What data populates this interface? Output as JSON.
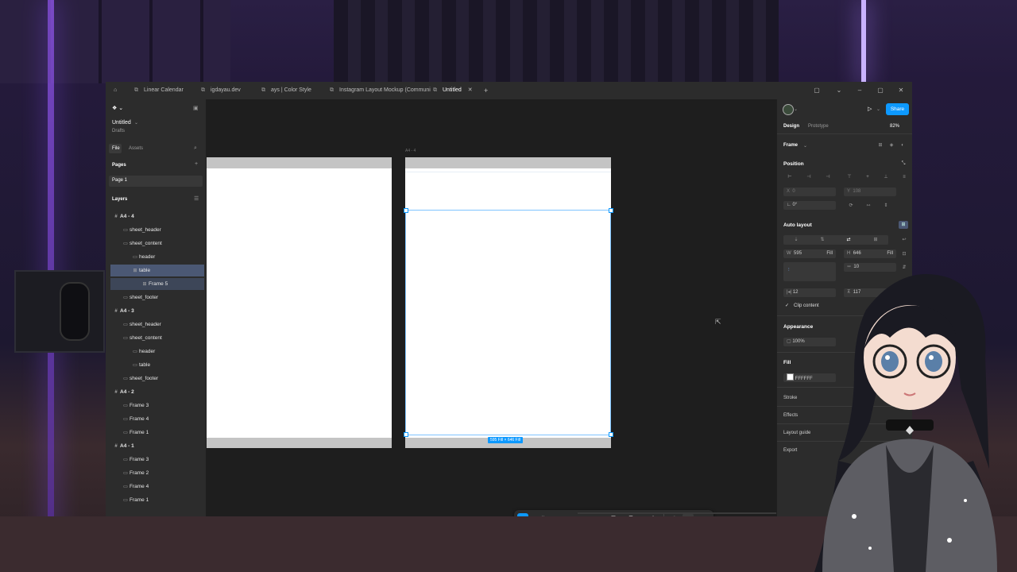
{
  "tabs": [
    {
      "label": "Linear Calendar",
      "icon": "figma-file-icon"
    },
    {
      "label": "igdayau.dev",
      "icon": "figma-file-icon"
    },
    {
      "label": "ays | Color Style",
      "icon": "figma-file-icon"
    },
    {
      "label": "Instagram Layout Mockup (Communi",
      "icon": "figma-file-icon"
    },
    {
      "label": "Untitled",
      "icon": "figma-file-icon",
      "active": true
    }
  ],
  "tab_add": "+",
  "file": {
    "name": "Untitled",
    "location": "Drafts"
  },
  "left_tabs": {
    "file": "File",
    "assets": "Assets"
  },
  "pages": {
    "heading": "Pages",
    "items": [
      "Page 1"
    ]
  },
  "layers": {
    "heading": "Layers",
    "items": [
      {
        "label": "A4 - 4",
        "level": 0,
        "icon": "#"
      },
      {
        "label": "sheet_header",
        "level": 1,
        "icon": "▭"
      },
      {
        "label": "sheet_content",
        "level": 1,
        "icon": "▭"
      },
      {
        "label": "header",
        "level": 2,
        "icon": "▭"
      },
      {
        "label": "table",
        "level": 2,
        "icon": "⊞",
        "selected": true
      },
      {
        "label": "Frame 5",
        "level": 3,
        "icon": "⊞",
        "child_selected": true
      },
      {
        "label": "sheet_footer",
        "level": 1,
        "icon": "▭"
      },
      {
        "label": "A4 - 3",
        "level": 0,
        "icon": "#"
      },
      {
        "label": "sheet_header",
        "level": 1,
        "icon": "▭"
      },
      {
        "label": "sheet_content",
        "level": 1,
        "icon": "▭"
      },
      {
        "label": "header",
        "level": 2,
        "icon": "▭"
      },
      {
        "label": "table",
        "level": 2,
        "icon": "▭"
      },
      {
        "label": "sheet_footer",
        "level": 1,
        "icon": "▭"
      },
      {
        "label": "A4 - 2",
        "level": 0,
        "icon": "#"
      },
      {
        "label": "Frame 3",
        "level": 1,
        "icon": "▭"
      },
      {
        "label": "Frame 4",
        "level": 1,
        "icon": "▭"
      },
      {
        "label": "Frame 1",
        "level": 1,
        "icon": "▭"
      },
      {
        "label": "A4 - 1",
        "level": 0,
        "icon": "#"
      },
      {
        "label": "Frame 3",
        "level": 1,
        "icon": "▭"
      },
      {
        "label": "Frame 2",
        "level": 1,
        "icon": "▭"
      },
      {
        "label": "Frame 4",
        "level": 1,
        "icon": "▭"
      },
      {
        "label": "Frame 1",
        "level": 1,
        "icon": "▭"
      }
    ]
  },
  "canvas": {
    "frame_label": "A4 - 4",
    "selection_label": "595 Fill × 646 Fill"
  },
  "right": {
    "share": "Share",
    "tabs": {
      "design": "Design",
      "prototype": "Prototype"
    },
    "zoom": "82%",
    "frame_type": "Frame",
    "position": {
      "heading": "Position",
      "x_label": "X",
      "x": "0",
      "y_label": "Y",
      "y": "108",
      "rotation": "0°"
    },
    "auto_layout": {
      "heading": "Auto layout",
      "w_label": "W",
      "w": "595",
      "w_mode": "Fill",
      "h_label": "H",
      "h": "646",
      "h_mode": "Fill",
      "gap": "10",
      "padding_h": "12",
      "padding_v": "117",
      "clip": "Clip content"
    },
    "appearance": {
      "heading": "Appearance",
      "opacity": "100%"
    },
    "fill": {
      "heading": "Fill",
      "color_hex": "FFFFFF",
      "color": "#FFFFFF"
    },
    "stroke": "Stroke",
    "effects": "Effects",
    "layout_guide": "Layout guide",
    "export": "Export"
  },
  "colors": {
    "accent": "#0d99ff",
    "selection": "#4b5874"
  }
}
